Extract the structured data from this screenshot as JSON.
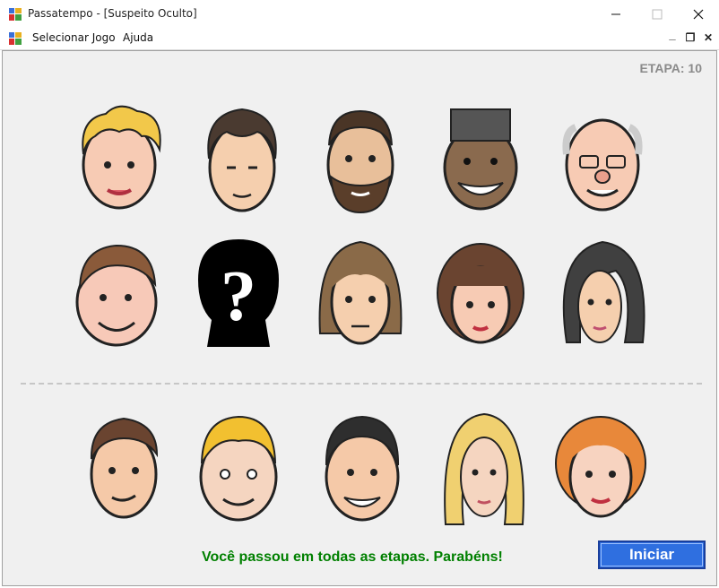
{
  "window": {
    "title": "Passatempo - [Suspeito Oculto]",
    "minimize_icon": "minimize-icon",
    "maximize_icon": "maximize-icon",
    "close_icon": "close-icon"
  },
  "menu": {
    "items": [
      "Selecionar Jogo",
      "Ajuda"
    ],
    "mdi_controls": [
      "_",
      "❐",
      "✕"
    ]
  },
  "game": {
    "stage_label": "ETAPA: 10",
    "suspects_row1": [
      "curly-blonde-woman",
      "dark-haired-young-man",
      "bearded-man",
      "flat-top-smiling-man",
      "bald-old-man-with-glasses"
    ],
    "suspects_row2": [
      "smiling-chubby-man",
      "hidden-suspect-question-mark",
      "shaggy-brown-haired-man",
      "bob-haired-woman",
      "dark-long-haired-woman"
    ],
    "choices": [
      "brown-haired-boy",
      "blond-spiky-man",
      "black-haired-grinning-man",
      "long-blonde-woman",
      "red-haired-woman"
    ],
    "message": "Você passou em todas as etapas. Parabéns!",
    "start_button": "Iniciar"
  },
  "colors": {
    "client_bg": "#f0f0f0",
    "message": "#008000",
    "button": "#2f6fe0",
    "stage": "#8a8a8a"
  }
}
